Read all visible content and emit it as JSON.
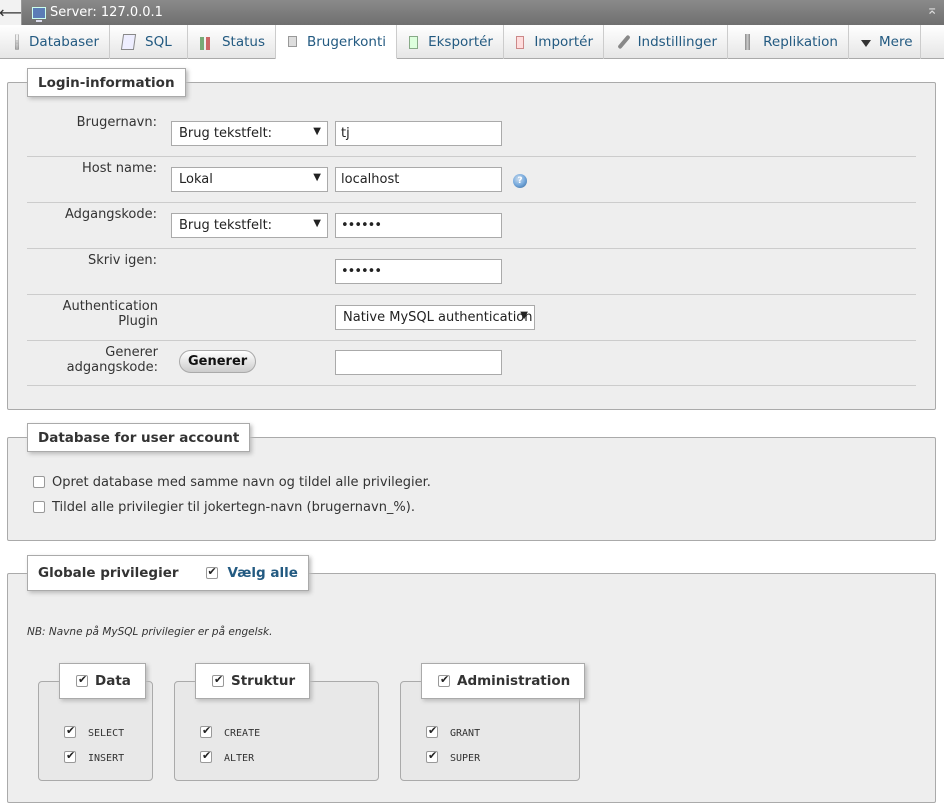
{
  "serverbar": {
    "title": "Server: 127.0.0.1",
    "back_glyph": "⟵",
    "collapse_glyph": "⌅"
  },
  "tabs": [
    {
      "label": "Databaser",
      "icon": "database-icon"
    },
    {
      "label": "SQL",
      "icon": "sql-icon"
    },
    {
      "label": "Status",
      "icon": "status-icon"
    },
    {
      "label": "Brugerkonti",
      "icon": "user-accounts-icon",
      "active": true
    },
    {
      "label": "Eksportér",
      "icon": "export-icon"
    },
    {
      "label": "Importér",
      "icon": "import-icon"
    },
    {
      "label": "Indstillinger",
      "icon": "settings-icon"
    },
    {
      "label": "Replikation",
      "icon": "replication-icon"
    },
    {
      "label": "Mere",
      "icon": "chevron-down-icon"
    }
  ],
  "login": {
    "legend": "Login-information",
    "username": {
      "label": "Brugernavn:",
      "select": "Brug tekstfelt:",
      "value": "tj"
    },
    "host": {
      "label": "Host name:",
      "select": "Lokal",
      "value": "localhost"
    },
    "password": {
      "label": "Adgangskode:",
      "select": "Brug tekstfelt:",
      "value": "••••••"
    },
    "retype": {
      "label": "Skriv igen:",
      "value": "••••••"
    },
    "auth_plugin": {
      "label": "Authentication Plugin",
      "select": "Native MySQL authentication"
    },
    "generate": {
      "label": "Generer adgangskode:",
      "button": "Generer",
      "value": ""
    }
  },
  "database": {
    "legend": "Database for user account",
    "option1": "Opret database med samme navn og tildel alle privilegier.",
    "option2": "Tildel alle privilegier til jokertegn-navn (brugernavn_%)."
  },
  "global": {
    "legend": "Globale privilegier",
    "select_all": "Vælg alle",
    "note": "NB: Navne på MySQL privilegier er på engelsk.",
    "groups": {
      "data": {
        "label": "Data",
        "items": [
          "SELECT",
          "INSERT"
        ]
      },
      "structure": {
        "label": "Struktur",
        "items": [
          "CREATE",
          "ALTER"
        ]
      },
      "admin": {
        "label": "Administration",
        "items": [
          "GRANT",
          "SUPER"
        ]
      }
    }
  }
}
